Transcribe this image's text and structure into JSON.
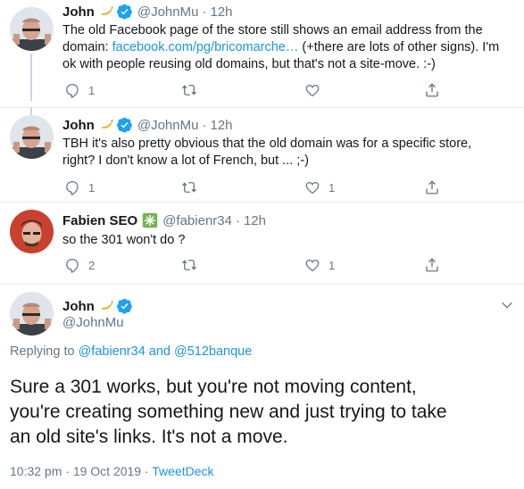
{
  "tweets": [
    {
      "name": "John",
      "emoji": "banana-emoji",
      "verified": true,
      "handle": "@JohnMu",
      "separator": "·",
      "time": "12h",
      "text_line1": "The old Facebook page of the store still shows an email address from the",
      "text_line2_prefix": "domain: ",
      "link": "facebook.com/pg/bricomarche…",
      "text_line2_suffix": " (+there are lots of other signs). I'm",
      "text_line3": "ok with people reusing old domains, but that's not a site-move. :-)",
      "replies": "1",
      "retweets": "",
      "likes": ""
    },
    {
      "name": "John",
      "emoji": "banana-emoji",
      "verified": true,
      "handle": "@JohnMu",
      "separator": "·",
      "time": "12h",
      "text_line1": "TBH it's also pretty obvious that the old domain was for a specific store,",
      "text_line2": "right? I don't know a lot of French, but ... ;-)",
      "replies": "1",
      "retweets": "",
      "likes": "1"
    },
    {
      "name": "Fabien SEO",
      "emoji": "sparkle-emoji",
      "verified": false,
      "handle": "@fabienr34",
      "separator": "·",
      "time": "12h",
      "text_line1": "so the 301 won't do ?",
      "replies": "2",
      "retweets": "",
      "likes": "1"
    }
  ],
  "focus": {
    "name": "John",
    "emoji": "banana-emoji",
    "verified": true,
    "handle": "@JohnMu",
    "replying_prefix": "Replying to ",
    "replying_user1": "@fabienr34",
    "replying_and": " and ",
    "replying_user2": "@512banque",
    "text_line1": "Sure a 301 works, but you're not moving content,",
    "text_line2": "you're creating something new and just trying to take",
    "text_line3": "an old site's links. It's not a move.",
    "timestamp": "10:32 pm · 19 Oct 2019 · ",
    "client": "TweetDeck"
  },
  "colors": {
    "link": "#1b95e0",
    "muted": "#657786",
    "verified": "#1da1f2",
    "banana": "#f5d04a",
    "sparkle": "#77b255"
  },
  "icons": [
    "reply-icon",
    "retweet-icon",
    "like-icon",
    "share-icon",
    "verified-badge-icon",
    "chevron-down-icon"
  ]
}
